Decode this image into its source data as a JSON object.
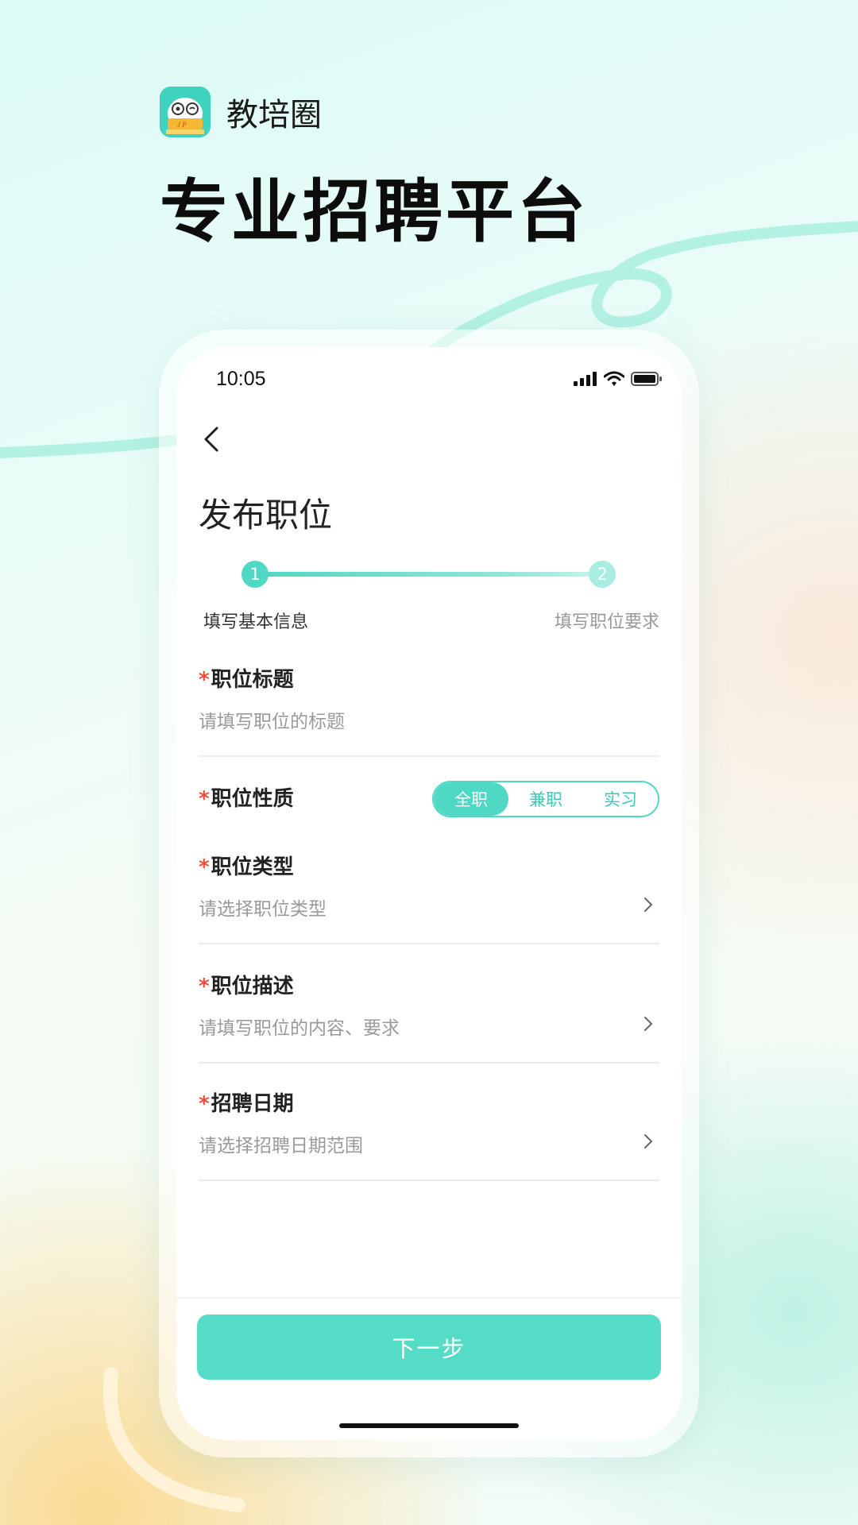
{
  "brand": {
    "name": "教培圈",
    "logo_icon": "owl-mascot-icon"
  },
  "headline": "专业招聘平台",
  "status_bar": {
    "time": "10:05"
  },
  "page": {
    "title": "发布职位"
  },
  "steps": {
    "items": [
      {
        "number": "1",
        "label": "填写基本信息",
        "active": true
      },
      {
        "number": "2",
        "label": "填写职位要求",
        "active": false
      }
    ]
  },
  "form": {
    "required_mark": "*",
    "job_title": {
      "label": "职位标题",
      "placeholder": "请填写职位的标题"
    },
    "job_nature": {
      "label": "职位性质",
      "options": [
        "全职",
        "兼职",
        "实习"
      ],
      "selected": "全职"
    },
    "job_type": {
      "label": "职位类型",
      "placeholder": "请选择职位类型"
    },
    "job_desc": {
      "label": "职位描述",
      "placeholder": "请填写职位的内容、要求"
    },
    "recruit_date": {
      "label": "招聘日期",
      "placeholder": "请选择招聘日期范围"
    }
  },
  "footer": {
    "next_label": "下一步"
  },
  "colors": {
    "accent": "#4fd8c3",
    "required": "#f24a3c",
    "placeholder": "#9a9a9a"
  }
}
